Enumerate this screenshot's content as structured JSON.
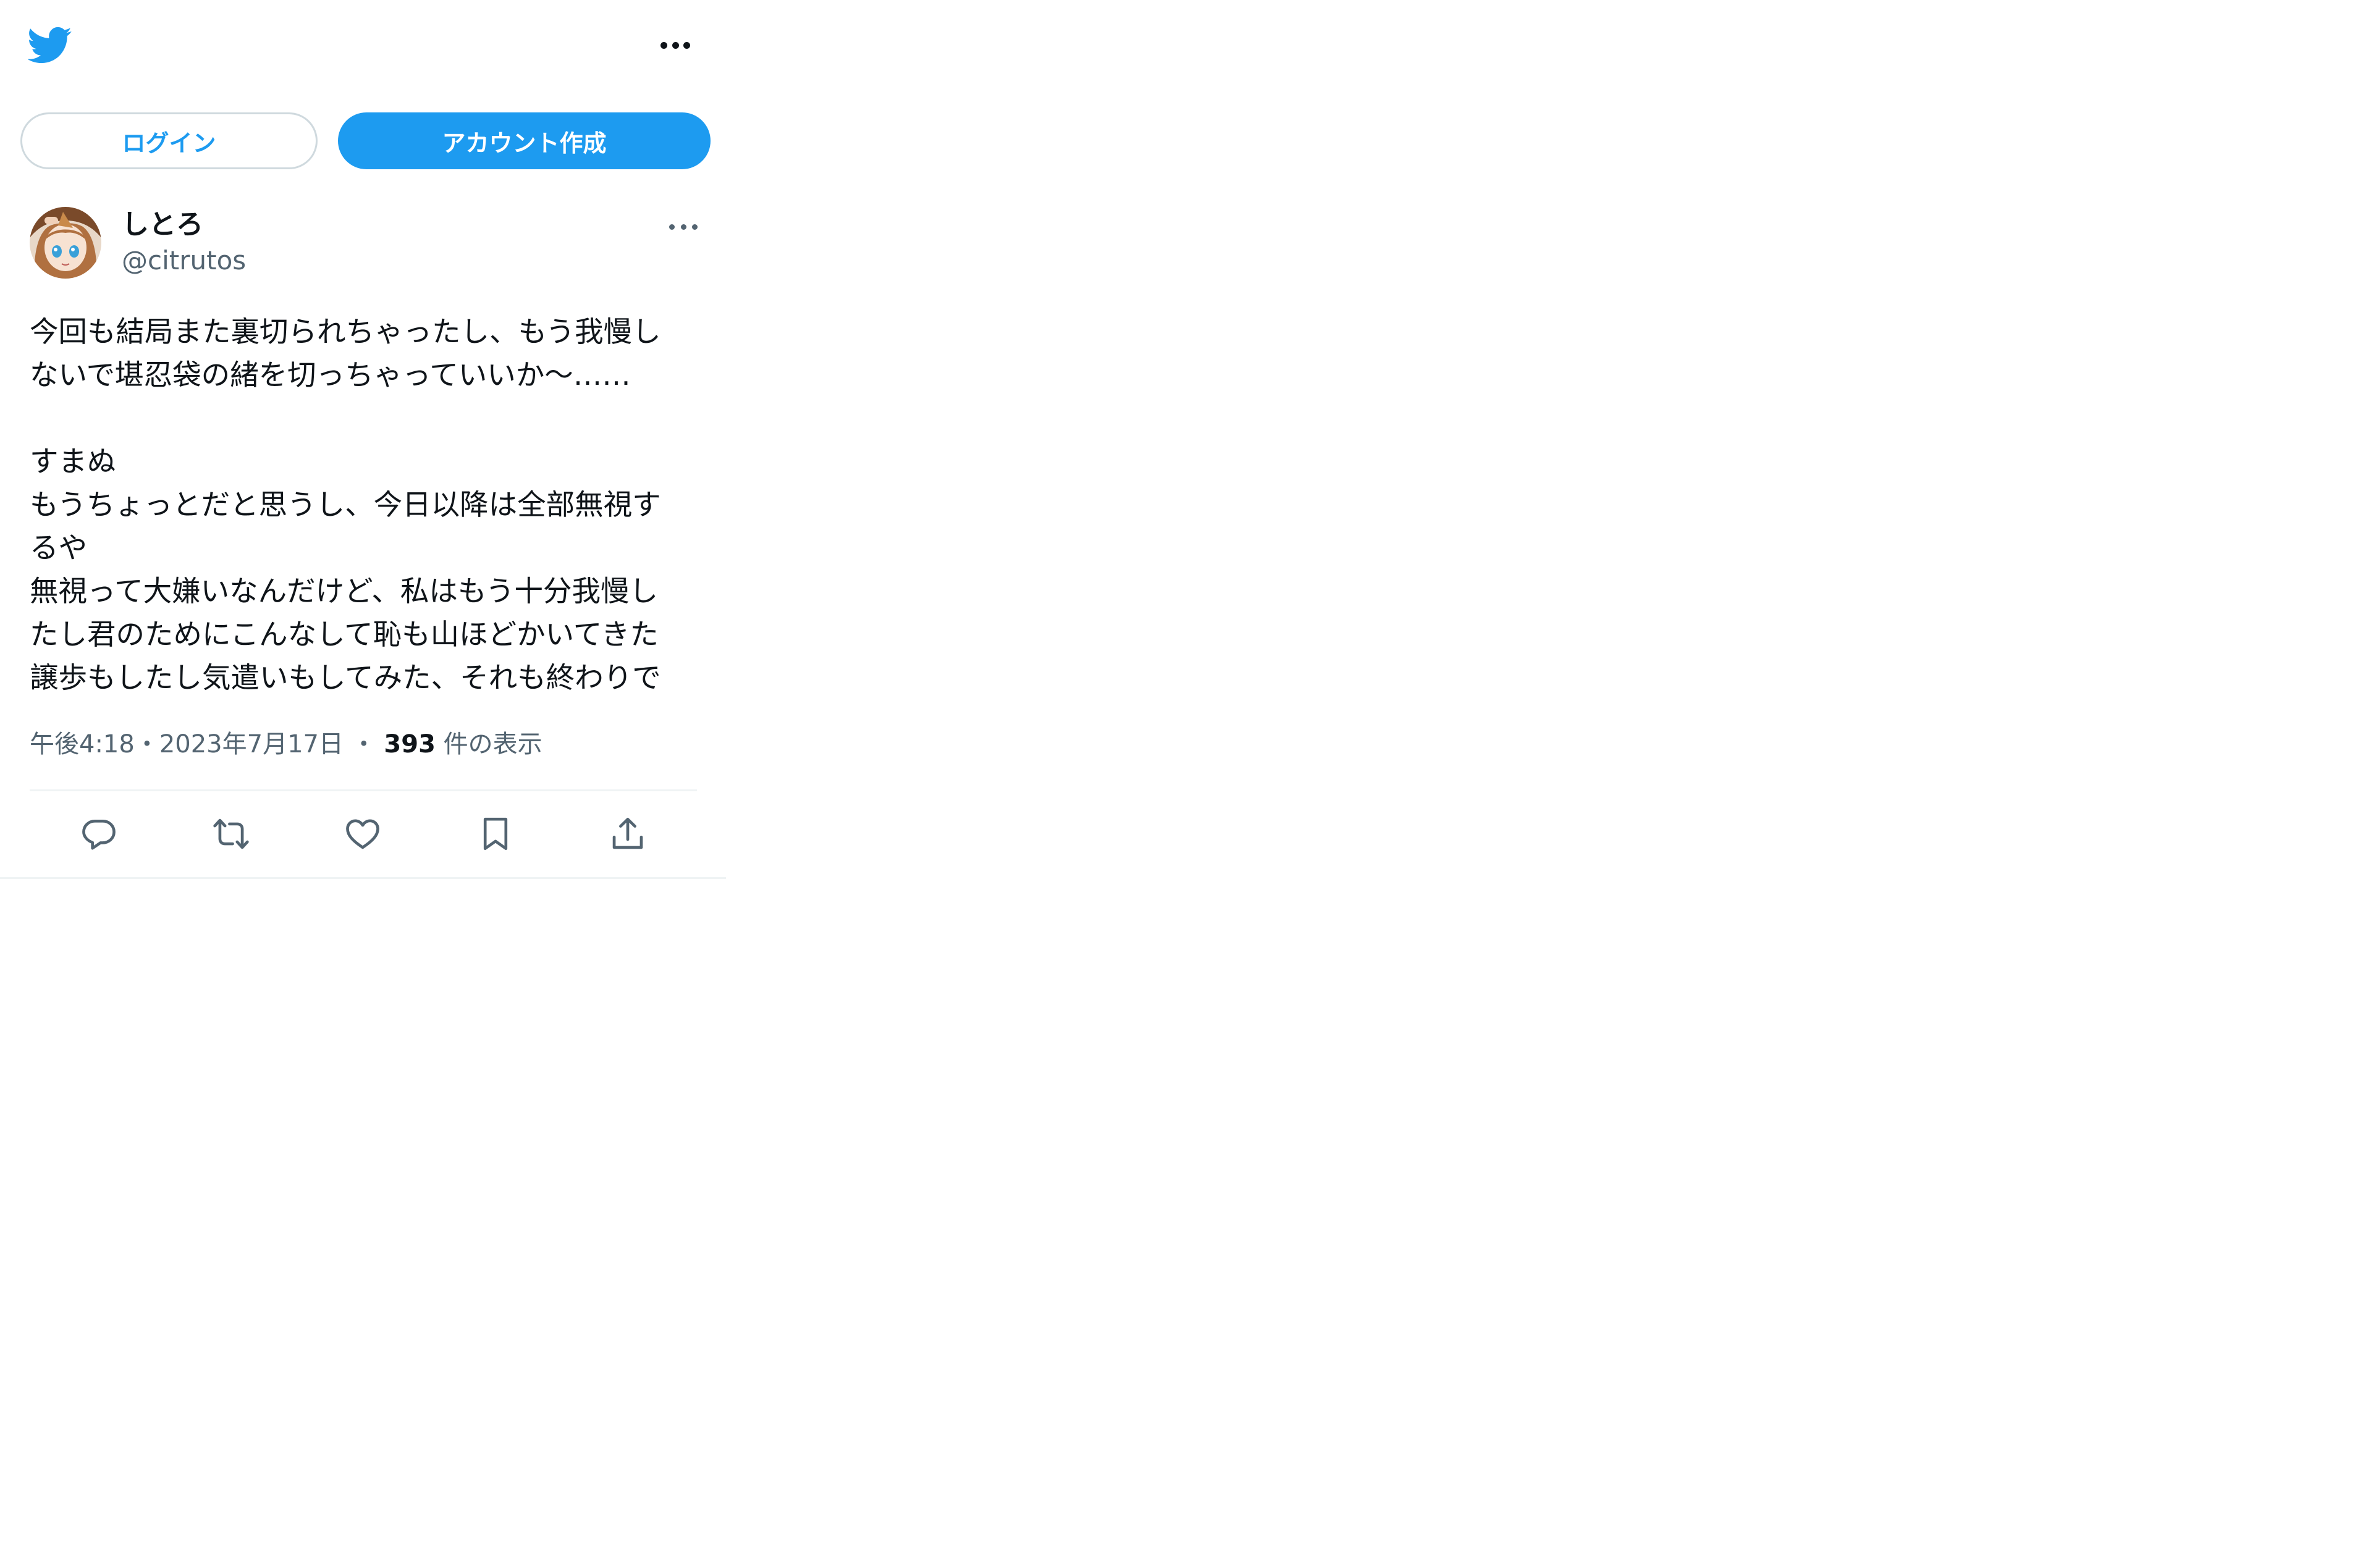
{
  "header": {
    "logo_icon": "twitter-bird-icon",
    "more_icon": "more-horizontal-icon"
  },
  "auth": {
    "login_label": "ログイン",
    "signup_label": "アカウント作成"
  },
  "tweet": {
    "author": {
      "display_name": "しとろ",
      "handle": "@citrutos"
    },
    "text_lines": [
      "今回も結局また裏切られちゃったし、もう我慢し",
      "ないで堪忍袋の緒を切っちゃっていいか〜……",
      "",
      "すまぬ",
      "もうちょっとだと思うし、今日以降は全部無視す",
      "るや",
      "無視って大嫌いなんだけど、私はもう十分我慢し",
      "たし君のためにこんなして恥も山ほどかいてきた",
      "譲歩もしたし気遣いもしてみた、それも終わりで"
    ],
    "time": "午後4:18",
    "separator": "・",
    "date": "2023年7月17日",
    "views_count": "393",
    "views_label": "件の表示"
  },
  "actions": {
    "icons": [
      "reply-icon",
      "retweet-icon",
      "like-icon",
      "bookmark-icon",
      "share-icon"
    ]
  },
  "colors": {
    "brand": "#1d9bf0",
    "text_primary": "#0f1419",
    "text_secondary": "#536471",
    "border": "#cfd9de",
    "divider": "#eff3f4"
  }
}
